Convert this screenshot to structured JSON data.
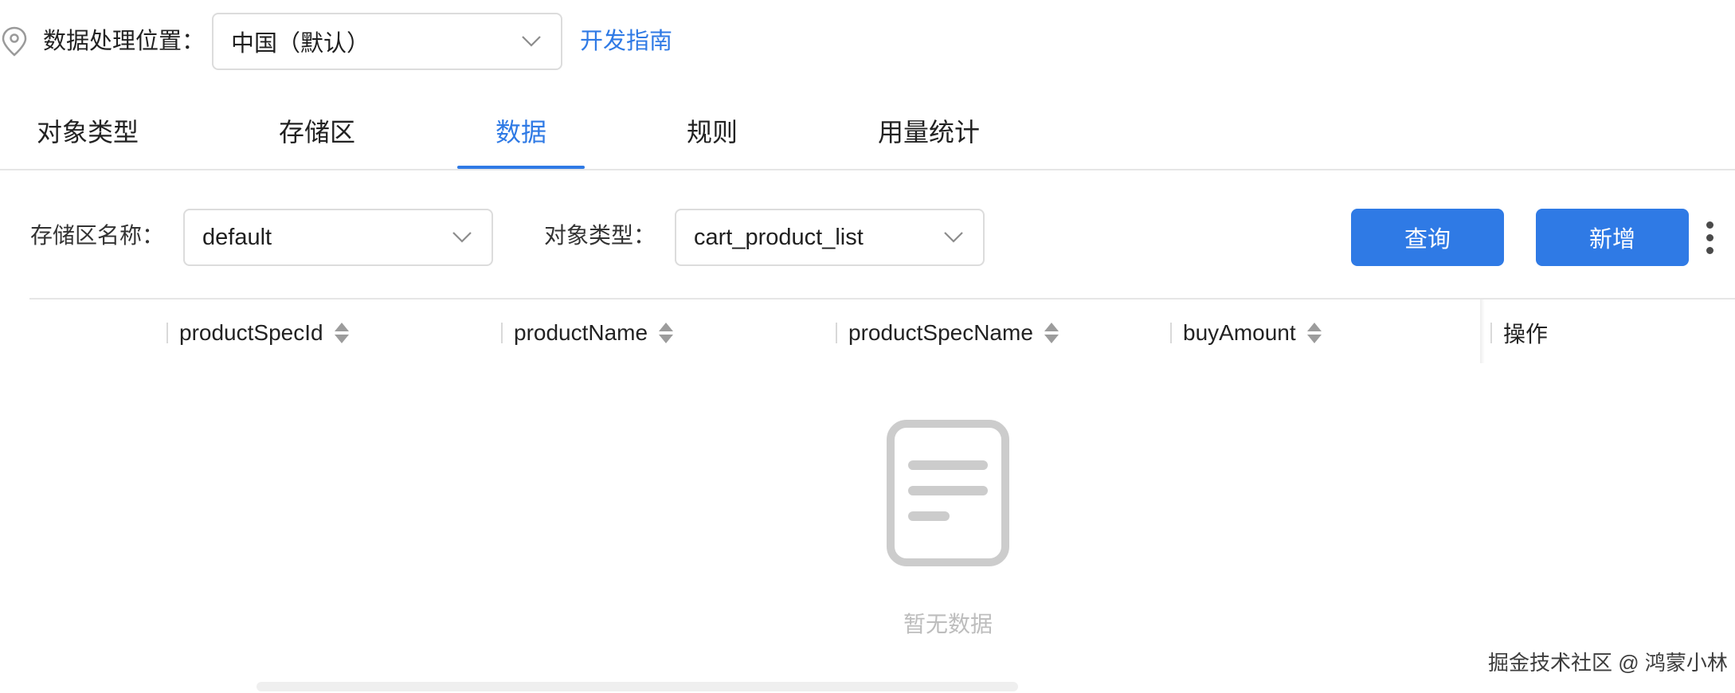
{
  "location": {
    "icon": "map-pin-icon",
    "label": "数据处理位置：",
    "region_value": "中国（默认）",
    "guide_link": "开发指南"
  },
  "tabs": [
    {
      "label": "对象类型",
      "active": false
    },
    {
      "label": "存储区",
      "active": false
    },
    {
      "label": "数据",
      "active": true
    },
    {
      "label": "规则",
      "active": false
    },
    {
      "label": "用量统计",
      "active": false
    }
  ],
  "filters": {
    "store_label": "存储区名称：",
    "store_value": "default",
    "type_label": "对象类型：",
    "type_value": "cart_product_list"
  },
  "buttons": {
    "query": "查询",
    "add": "新增"
  },
  "table": {
    "columns": [
      "productSpecId",
      "productName",
      "productSpecName",
      "buyAmount"
    ],
    "action_column": "操作"
  },
  "empty": {
    "icon": "document-empty-icon",
    "text": "暂无数据"
  },
  "watermark": "掘金技术社区 @ 鸿蒙小林",
  "colors": {
    "accent": "#2f7ae5",
    "divider": "#e6e6e6",
    "muted": "#bdbdbd"
  }
}
